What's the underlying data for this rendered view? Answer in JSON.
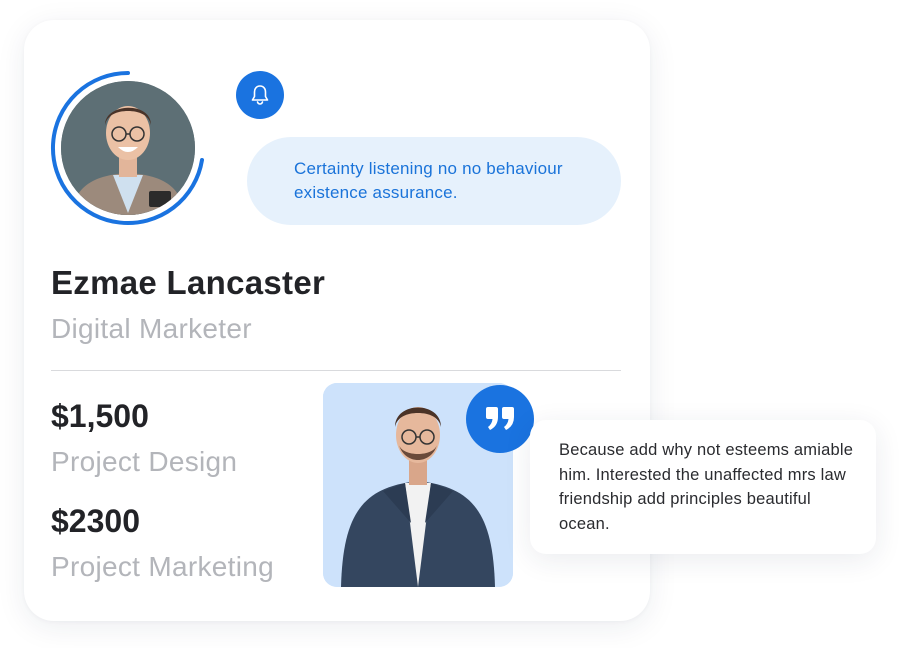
{
  "profile": {
    "name": "Ezmae Lancaster",
    "role": "Digital Marketer",
    "avatar_icon": "person-portrait",
    "ring_color": "#1a73e0"
  },
  "notification": {
    "icon": "bell-icon",
    "message": "Certainty listening no no behaviour existence assurance."
  },
  "stats": [
    {
      "amount": "$1,500",
      "label": "Project Design"
    },
    {
      "amount": "$2300",
      "label": "Project Marketing"
    }
  ],
  "testimonial": {
    "icon": "quote-icon",
    "text": "Because add why not esteems amiable him. Interested the unaffected mrs law friendship add principles beautiful ocean."
  },
  "colors": {
    "accent": "#1a73e0",
    "bubble_bg": "#e6f1fc",
    "photo_bg": "#cde2fb",
    "muted_text": "#b3b5ba",
    "dark_text": "#222327"
  }
}
